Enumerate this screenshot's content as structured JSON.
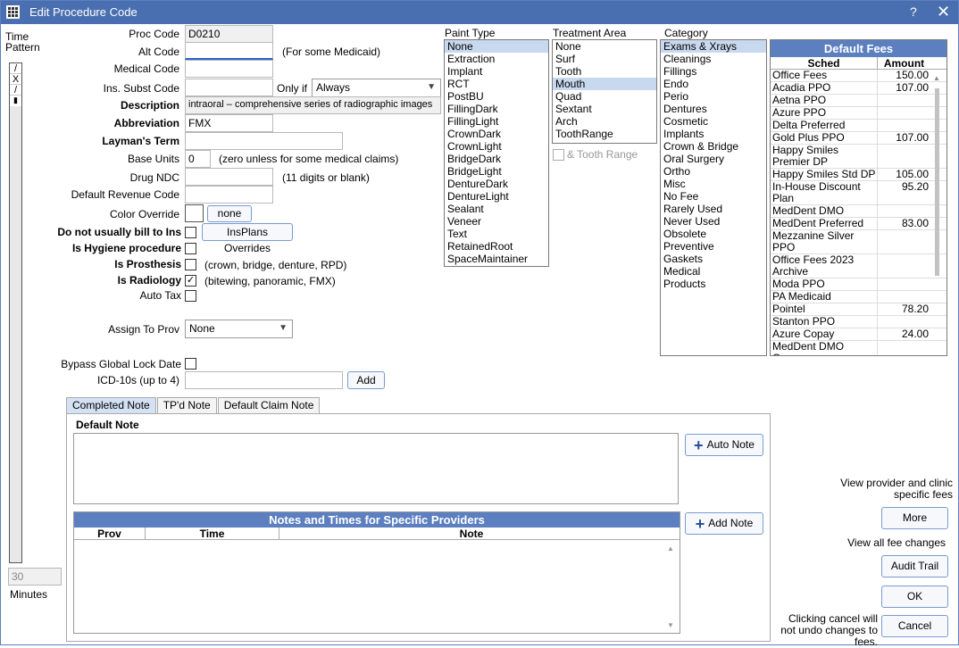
{
  "window": {
    "title": "Edit Procedure Code",
    "help": "?",
    "close": "✕"
  },
  "left": {
    "time_pattern": "Time\nPattern",
    "pattern_cells": [
      "/",
      "X",
      "/"
    ],
    "minutes_value": "30",
    "minutes_label": "Minutes"
  },
  "form": {
    "proc_code_label": "Proc Code",
    "proc_code": "D0210",
    "alt_code_label": "Alt Code",
    "alt_code": "",
    "alt_code_hint": "(For some Medicaid)",
    "medical_code_label": "Medical Code",
    "medical_code": "",
    "ins_subst_label": "Ins. Subst Code",
    "ins_subst": "",
    "only_if_label": "Only if",
    "only_if_value": "Always",
    "description_label": "Description",
    "description": "intraoral – comprehensive series of radiographic images",
    "abbreviation_label": "Abbreviation",
    "abbreviation": "FMX",
    "layman_label": "Layman's Term",
    "layman": "",
    "base_units_label": "Base Units",
    "base_units": "0",
    "base_units_hint": "(zero unless for some medical claims)",
    "drug_ndc_label": "Drug NDC",
    "drug_ndc": "",
    "drug_ndc_hint": "(11 digits or blank)",
    "revenue_label": "Default Revenue Code",
    "revenue": "",
    "color_label": "Color Override",
    "color_btn": "none",
    "no_bill_label": "Do not usually bill to Ins",
    "insplans_btn": "InsPlans Overrides",
    "hygiene_label": "Is Hygiene procedure",
    "prosthesis_label": "Is Prosthesis",
    "prosthesis_hint": "(crown, bridge, denture, RPD)",
    "radiology_label": "Is Radiology",
    "radiology_hint": "(bitewing, panoramic, FMX)",
    "autotax_label": "Auto Tax",
    "assign_label": "Assign To Prov",
    "assign_value": "None",
    "bypass_label": "Bypass Global Lock Date",
    "icd_label": "ICD-10s (up to 4)",
    "icd_value": "",
    "add_btn": "Add"
  },
  "paint_type": {
    "label": "Paint Type",
    "items": [
      "None",
      "Extraction",
      "Implant",
      "RCT",
      "PostBU",
      "FillingDark",
      "FillingLight",
      "CrownDark",
      "CrownLight",
      "BridgeDark",
      "BridgeLight",
      "DentureDark",
      "DentureLight",
      "Sealant",
      "Veneer",
      "Text",
      "RetainedRoot",
      "SpaceMaintainer"
    ],
    "selected": "None"
  },
  "treatment_area": {
    "label": "Treatment Area",
    "items": [
      "None",
      "Surf",
      "Tooth",
      "Mouth",
      "Quad",
      "Sextant",
      "Arch",
      "ToothRange"
    ],
    "selected": "Mouth",
    "tooth_range_label": "& Tooth Range"
  },
  "category": {
    "label": "Category",
    "items": [
      "Exams & Xrays",
      "Cleanings",
      "Fillings",
      "Endo",
      "Perio",
      "Dentures",
      "Cosmetic",
      "Implants",
      "Crown & Bridge",
      "Oral Surgery",
      "Ortho",
      "Misc",
      "No Fee",
      "Rarely Used",
      "Never Used",
      "Obsolete",
      "Preventive",
      "Gaskets",
      "Medical",
      "Products"
    ],
    "selected": "Exams & Xrays"
  },
  "fees": {
    "header": "Default Fees",
    "col_sched": "Sched",
    "col_amount": "Amount",
    "rows": [
      {
        "sched": "Office Fees",
        "amount": "150.00"
      },
      {
        "sched": "Acadia PPO",
        "amount": "107.00"
      },
      {
        "sched": "Aetna PPO",
        "amount": ""
      },
      {
        "sched": "Azure PPO",
        "amount": ""
      },
      {
        "sched": "Delta Preferred",
        "amount": ""
      },
      {
        "sched": "Gold Plus PPO",
        "amount": "107.00"
      },
      {
        "sched": "Happy Smiles Premier DP",
        "amount": ""
      },
      {
        "sched": "Happy Smiles Std DP",
        "amount": "105.00"
      },
      {
        "sched": "In-House Discount Plan",
        "amount": "95.20"
      },
      {
        "sched": "MedDent DMO",
        "amount": ""
      },
      {
        "sched": "MedDent Preferred",
        "amount": "83.00"
      },
      {
        "sched": "Mezzanine Silver PPO",
        "amount": ""
      },
      {
        "sched": "Office Fees 2023 Archive",
        "amount": ""
      },
      {
        "sched": "Moda PPO",
        "amount": ""
      },
      {
        "sched": "PA Medicaid",
        "amount": ""
      },
      {
        "sched": "Pointel",
        "amount": "78.20"
      },
      {
        "sched": "Stanton PPO",
        "amount": ""
      },
      {
        "sched": "Azure Copay",
        "amount": "24.00"
      },
      {
        "sched": "MedDent DMO Copay",
        "amount": ""
      }
    ]
  },
  "tabs": {
    "items": [
      "Completed Note",
      "TP'd Note",
      "Default Claim Note"
    ],
    "active": "Completed Note"
  },
  "note": {
    "default_note_label": "Default Note",
    "auto_note_btn": "Auto Note",
    "add_note_btn": "Add Note",
    "grid_title": "Notes and Times for Specific Providers",
    "col_prov": "Prov",
    "col_time": "Time",
    "col_note": "Note"
  },
  "right": {
    "provider_text": "View provider and clinic specific fees",
    "more_btn": "More",
    "fee_changes_text": "View all fee changes",
    "audit_btn": "Audit Trail",
    "ok_btn": "OK",
    "cancel_text": "Clicking cancel will not undo changes to fees.",
    "cancel_btn": "Cancel"
  },
  "colors": {
    "titlebar": "#4a6fb0",
    "header": "#5c7fc0",
    "selection": "#c8d8ee"
  }
}
